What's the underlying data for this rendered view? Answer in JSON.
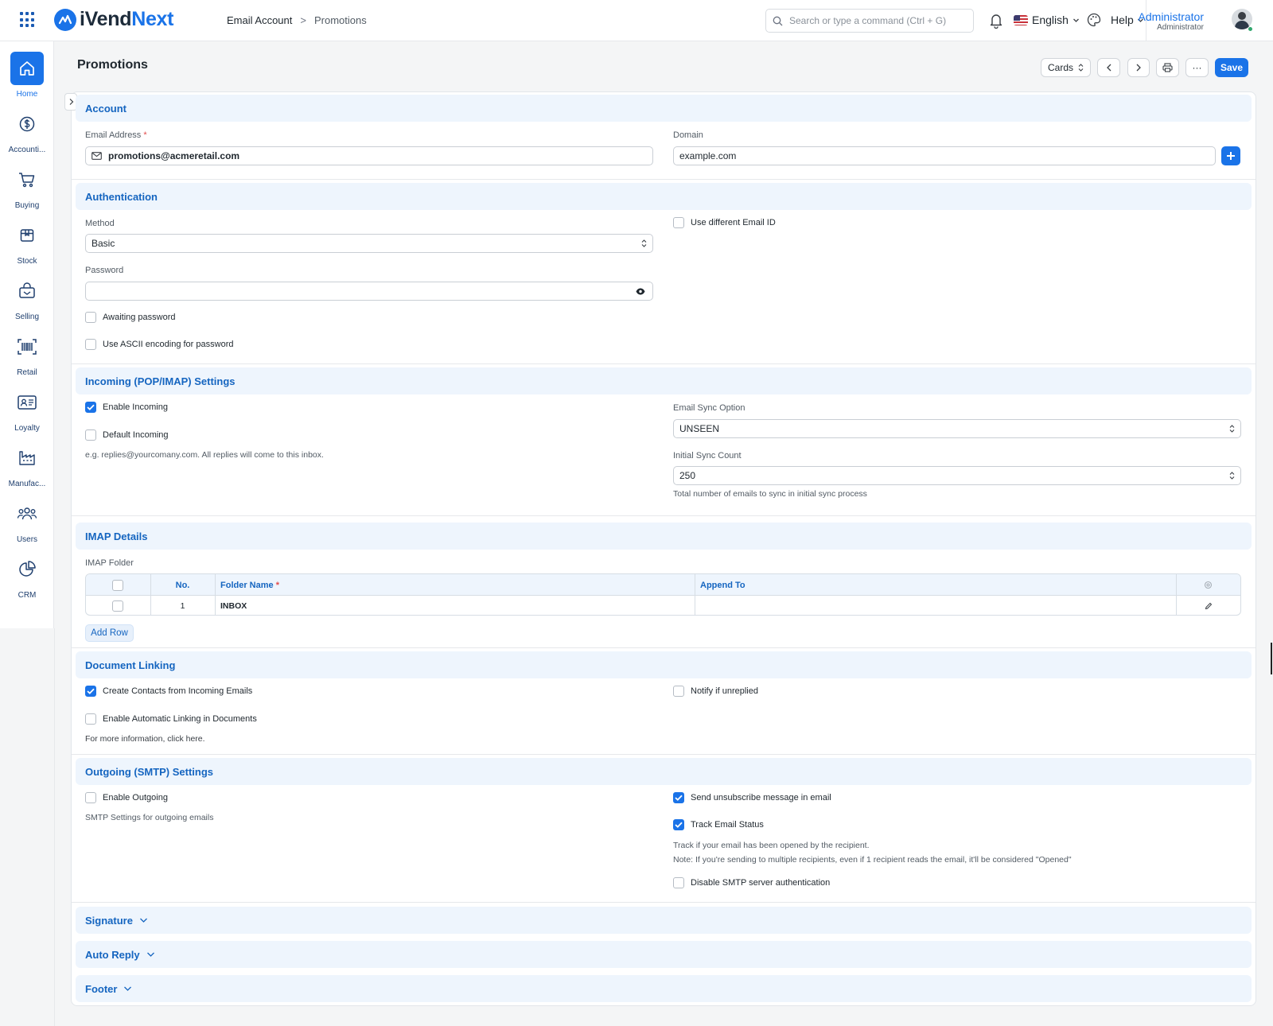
{
  "brand": {
    "name_part1": "iVend",
    "name_part2": "Next"
  },
  "breadcrumb": {
    "parent": "Email Account",
    "separator": ">",
    "current": "Promotions"
  },
  "search": {
    "placeholder": "Search or type a command (Ctrl + G)"
  },
  "header": {
    "language": "English",
    "help": "Help",
    "user_name": "Administrator",
    "user_role": "Administrator"
  },
  "sidebar": {
    "items": [
      {
        "label": "Home",
        "icon": "home-icon"
      },
      {
        "label": "Accounti...",
        "icon": "dollar-circle-icon"
      },
      {
        "label": "Buying",
        "icon": "cart-icon"
      },
      {
        "label": "Stock",
        "icon": "box-icon"
      },
      {
        "label": "Selling",
        "icon": "shopping-bag-icon"
      },
      {
        "label": "Retail",
        "icon": "barcode-icon"
      },
      {
        "label": "Loyalty",
        "icon": "id-card-icon"
      },
      {
        "label": "Manufac...",
        "icon": "factory-icon"
      },
      {
        "label": "Users",
        "icon": "users-icon"
      },
      {
        "label": "CRM",
        "icon": "pie-chart-icon"
      }
    ]
  },
  "page": {
    "title": "Promotions",
    "view_select": "Cards",
    "save": "Save",
    "more": "···"
  },
  "account": {
    "section": "Account",
    "email_label": "Email Address",
    "email_value": "promotions@acmeretail.com",
    "domain_label": "Domain",
    "domain_value": "example.com"
  },
  "authentication": {
    "section": "Authentication",
    "method_label": "Method",
    "method_value": "Basic",
    "use_different_email": "Use different Email ID",
    "password_label": "Password",
    "awaiting_password": "Awaiting password",
    "ascii_encoding": "Use ASCII encoding for password"
  },
  "incoming": {
    "section": "Incoming (POP/IMAP) Settings",
    "enable_incoming": "Enable Incoming",
    "enable_incoming_checked": true,
    "default_incoming": "Default Incoming",
    "default_hint": "e.g. replies@yourcomany.com. All replies will come to this inbox.",
    "sync_option_label": "Email Sync Option",
    "sync_option_value": "UNSEEN",
    "initial_sync_label": "Initial Sync Count",
    "initial_sync_value": "250",
    "initial_sync_hint": "Total number of emails to sync in initial sync process"
  },
  "imap": {
    "section": "IMAP Details",
    "folder_label": "IMAP Folder",
    "columns": {
      "no": "No.",
      "folder_name": "Folder Name",
      "append_to": "Append To"
    },
    "rows": [
      {
        "no": "1",
        "folder_name": "INBOX",
        "append_to": ""
      }
    ],
    "add_row": "Add Row"
  },
  "document_linking": {
    "section": "Document Linking",
    "create_contacts": "Create Contacts from Incoming Emails",
    "create_contacts_checked": true,
    "notify_unreplied": "Notify if unreplied",
    "auto_linking": "Enable Automatic Linking in Documents",
    "more_info": "For more information, click here."
  },
  "outgoing": {
    "section": "Outgoing (SMTP) Settings",
    "enable_outgoing": "Enable Outgoing",
    "smtp_hint": "SMTP Settings for outgoing emails",
    "send_unsubscribe": "Send unsubscribe message in email",
    "send_unsubscribe_checked": true,
    "track_status": "Track Email Status",
    "track_status_checked": true,
    "track_hint1": "Track if your email has been opened by the recipient.",
    "track_hint2": "Note: If you're sending to multiple recipients, even if 1 recipient reads the email, it'll be considered \"Opened\"",
    "disable_smtp_auth": "Disable SMTP server authentication"
  },
  "collapsed_sections": {
    "signature": "Signature",
    "auto_reply": "Auto Reply",
    "footer": "Footer"
  },
  "colors": {
    "accent": "#1a73e8",
    "section_bg": "#eef5fd",
    "section_text": "#1565c0"
  }
}
